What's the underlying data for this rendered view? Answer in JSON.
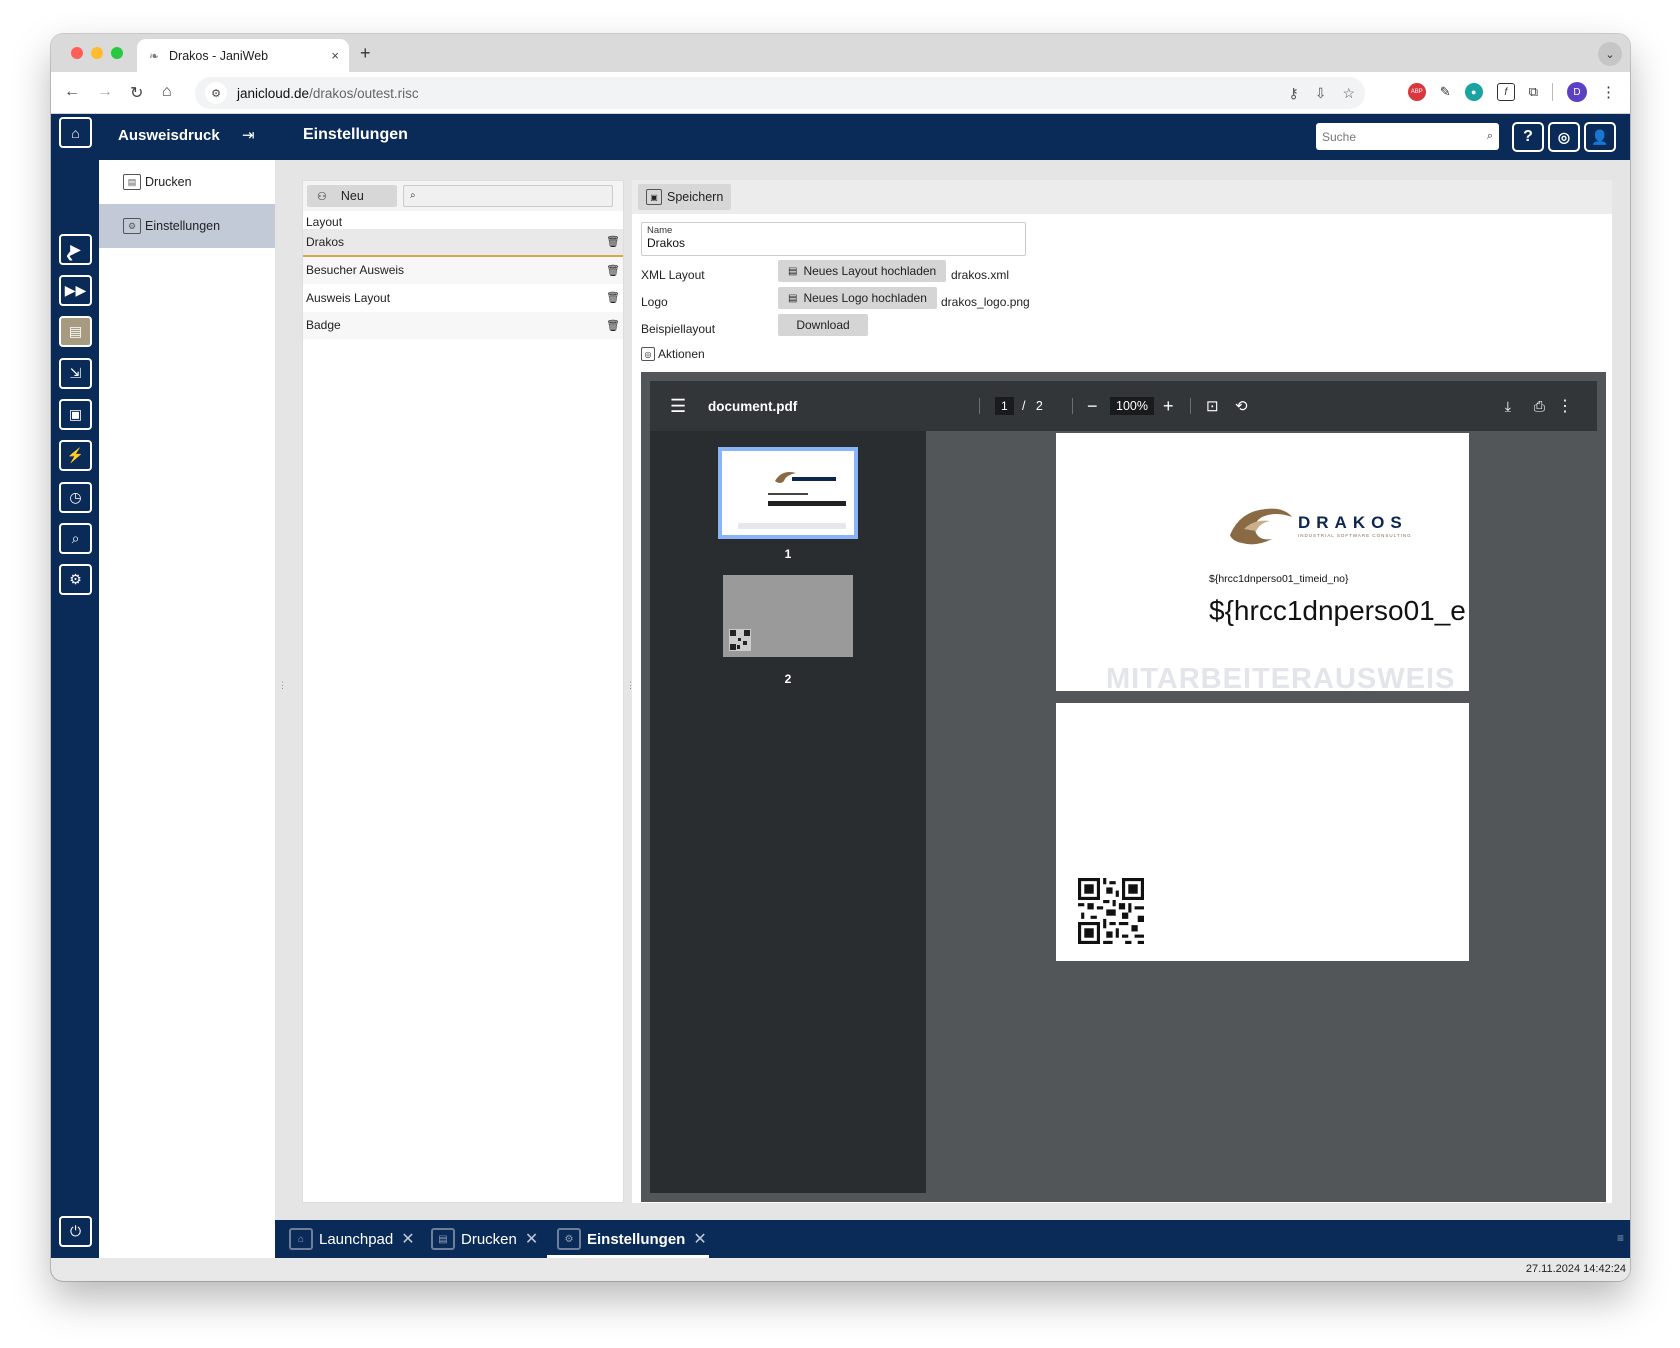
{
  "browser": {
    "tab_title": "Drakos - JaniWeb",
    "url_domain": "janicloud.de",
    "url_path": "/drakos/outest.risc",
    "new_tab": "+",
    "tab_close": "×"
  },
  "app": {
    "module_title": "Ausweisdruck",
    "page_title": "Einstellungen",
    "search_placeholder": "Suche",
    "help_label": "?"
  },
  "sidebar": {
    "items": [
      {
        "label": "Drucken"
      },
      {
        "label": "Einstellungen"
      }
    ]
  },
  "layouts": {
    "new_label": "Neu",
    "header": "Layout",
    "items": [
      {
        "name": "Drakos"
      },
      {
        "name": "Besucher Ausweis"
      },
      {
        "name": "Ausweis Layout"
      },
      {
        "name": "Badge"
      }
    ]
  },
  "detail": {
    "save_label": "Speichern",
    "name_label": "Name",
    "name_value": "Drakos",
    "xml_label": "XML Layout",
    "xml_button": "Neues Layout hochladen",
    "xml_file": "drakos.xml",
    "logo_label": "Logo",
    "logo_button": "Neues Logo hochladen",
    "logo_file": "drakos_logo.png",
    "example_label": "Beispiellayout",
    "download_label": "Download",
    "actions_label": "Aktionen"
  },
  "pdf": {
    "filename": "document.pdf",
    "current_page": "1",
    "page_separator": "/",
    "total_pages": "2",
    "zoom": "100%",
    "thumb1_label": "1",
    "thumb2_label": "2",
    "logo_word": "DRAKOS",
    "logo_tagline": "INDUSTRIAL SOFTWARE CONSULTING",
    "field_small": "${hrcc1dnperso01_timeid_no}",
    "field_big": "${hrcc1dnperso01_e",
    "watermark": "MITARBEITERAUSWEIS"
  },
  "bottom_tabs": [
    {
      "label": "Launchpad"
    },
    {
      "label": "Drucken"
    },
    {
      "label": "Einstellungen"
    }
  ],
  "status": {
    "timestamp": "27.11.2024 14:42:24"
  },
  "colors": {
    "primary": "#0a2b57",
    "selected_accent": "#d7a64f",
    "sidebar_selected": "#c2cad8"
  }
}
